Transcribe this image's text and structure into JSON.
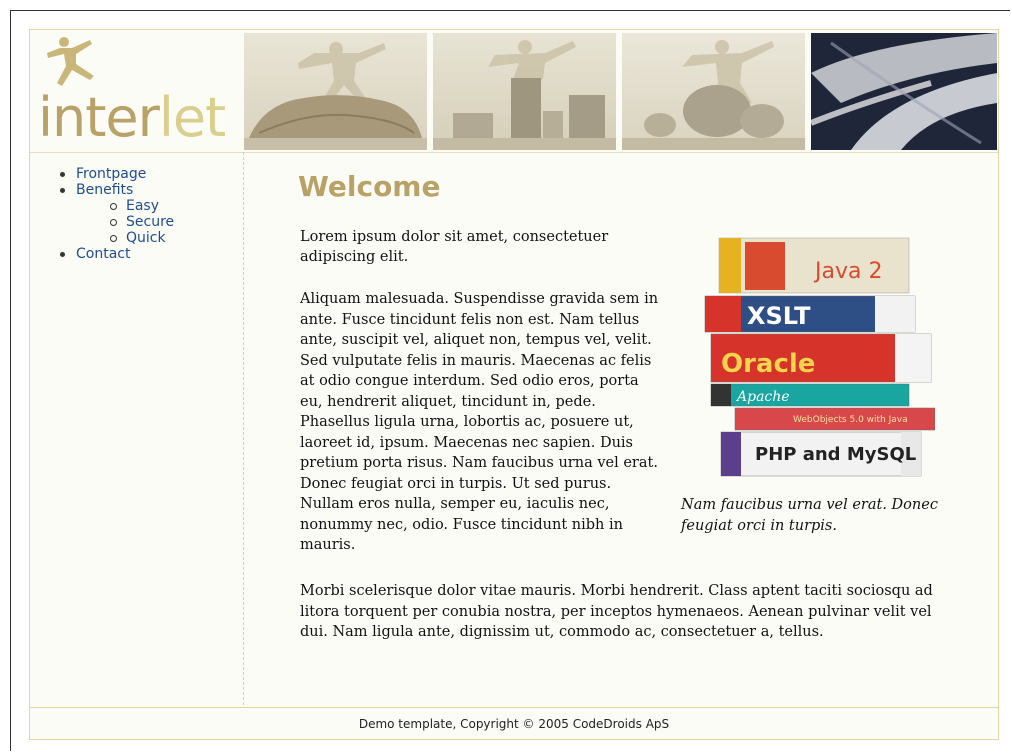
{
  "logo": {
    "part1": "inter",
    "part2": "let"
  },
  "nav": {
    "items": [
      {
        "label": "Frontpage"
      },
      {
        "label": "Benefits"
      },
      {
        "label": "Easy"
      },
      {
        "label": "Secure"
      },
      {
        "label": "Quick"
      },
      {
        "label": "Contact"
      }
    ]
  },
  "page": {
    "title": "Welcome",
    "intro": "Lorem ipsum dolor sit amet, consectetuer adipiscing elit.",
    "main": "Aliquam malesuada. Suspendisse gravida sem in ante. Fusce tincidunt felis non est. Nam tellus ante, suscipit vel, aliquet non, tempus vel, velit. Sed vulputate felis in mauris. Maecenas ac felis at odio congue interdum. Sed odio eros, porta eu, hendrerit aliquet, tincidunt in, pede. Phasellus ligula urna, lobortis ac, posuere ut, laoreet id, ipsum. Maecenas nec sapien. Duis pretium porta risus. Nam faucibus urna vel erat. Donec feugiat orci in turpis. Ut sed purus. Nullam eros nulla, semper eu, iaculis nec, nonummy nec, odio. Fusce tincidunt nibh in mauris.",
    "caption": "Nam faucibus urna vel erat. Donec feugiat orci in turpis.",
    "last": "Morbi scelerisque dolor vitae mauris. Morbi hendrerit. Class aptent taciti sociosqu ad litora torquent per conubia nostra, per inceptos hymenaeos. Aenean pulvinar velit vel dui. Nam ligula ante, dignissim ut, commodo ac, consectetuer a, tellus."
  },
  "books": [
    {
      "title": "Java 2",
      "color": "#e8e0c8"
    },
    {
      "title": "XSLT",
      "color": "#2e4f86"
    },
    {
      "title": "Oracle",
      "color": "#d6332b"
    },
    {
      "title": "Apache",
      "color": "#1aa6a0"
    },
    {
      "title": "WebObjects 5.0 with Java",
      "color": "#d8484b"
    },
    {
      "title": "PHP and MySQL",
      "color": "#f2f2f2"
    }
  ],
  "footer": {
    "text": "Demo template, Copyright © 2005 CodeDroids ApS"
  }
}
